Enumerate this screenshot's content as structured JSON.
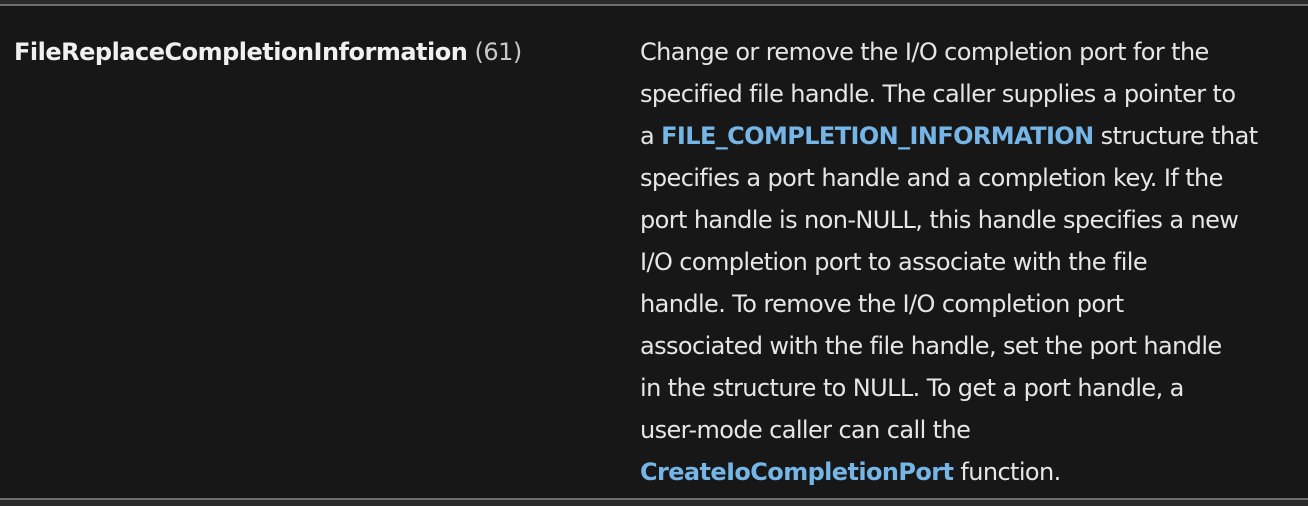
{
  "row": {
    "name": "FileReplaceCompletionInformation",
    "code": "(61)",
    "description": {
      "line1": "Change or remove the I/O completion port for the",
      "line2": "specified file handle. The caller supplies a pointer to",
      "line3_pre": "a ",
      "line3_link": "FILE_COMPLETION_INFORMATION",
      "line3_post": " structure that",
      "line4": "specifies a port handle and a completion key. If the",
      "line5": "port handle is non-NULL, this handle specifies a new",
      "line6": "I/O completion port to associate with the file",
      "line7": "handle. To remove the I/O completion port",
      "line8": "associated with the file handle, set the port handle",
      "line9": "in the structure to NULL. To get a port handle, a",
      "line10": "user-mode caller can call the",
      "line11_link": "CreateIoCompletionPort",
      "line11_post": " function."
    }
  },
  "colors": {
    "background": "#171717",
    "text": "#e6e6e6",
    "link": "#75b6e7",
    "border": "#6e6e6e"
  }
}
